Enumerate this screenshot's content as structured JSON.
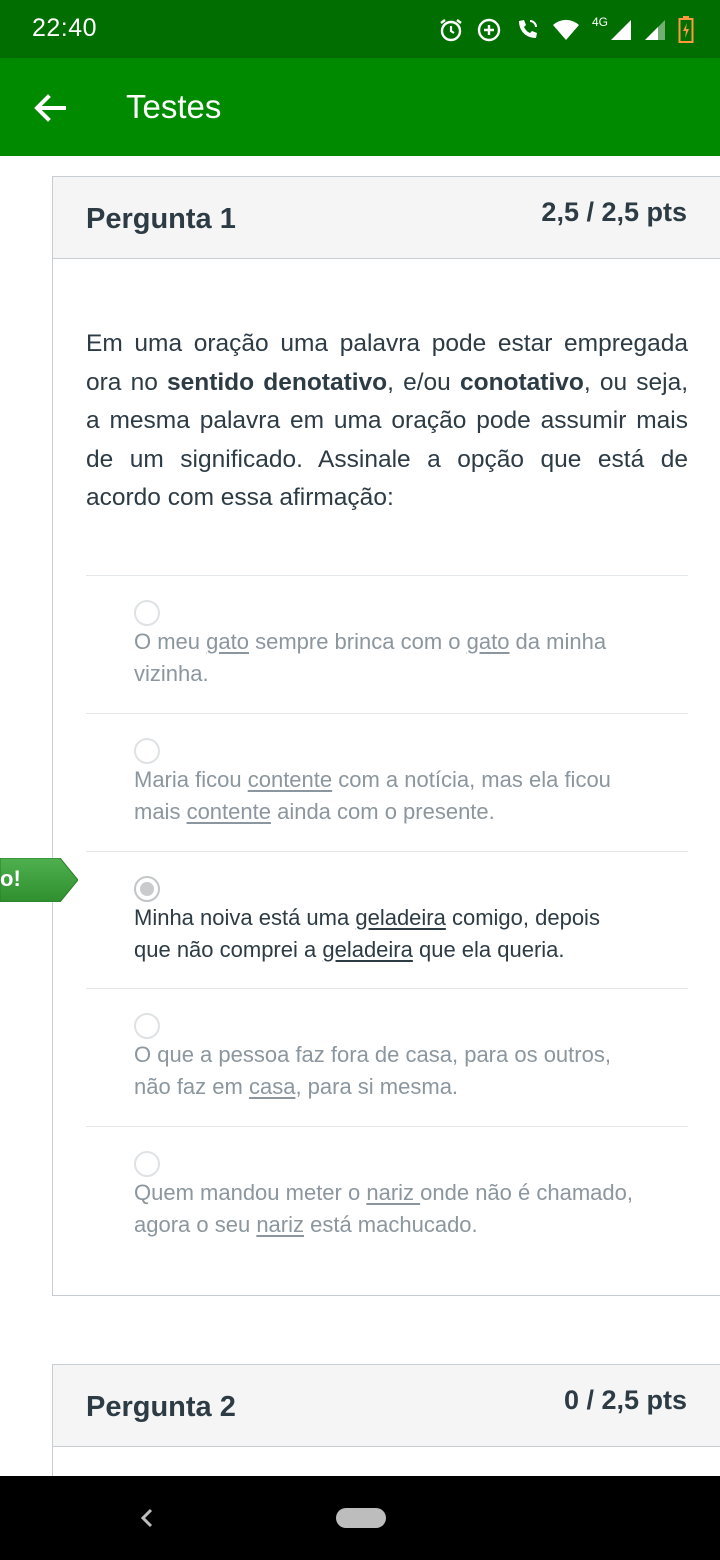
{
  "status_bar": {
    "time": "22:40",
    "network_label": "4G",
    "icons": [
      "alarm-icon",
      "data-saver-icon",
      "wifi-calling-icon",
      "wifi-icon",
      "signal-icon",
      "signal-icon-2",
      "battery-charging-icon"
    ]
  },
  "app_bar": {
    "title": "Testes",
    "back_icon": "arrow-left-icon"
  },
  "questions": [
    {
      "name": "Pergunta 1",
      "points": "2,5 / 2,5 pts",
      "text_parts": {
        "p1": "Em uma oração uma palavra pode estar empregada ora no ",
        "b1": "sentido denotativo",
        "p2": ", e/ou ",
        "b2": "conotativo",
        "p3": ", ou seja, a mesma palavra em uma oração pode assumir mais de um significado. Assinale a opção que está de acordo com essa afirmação:"
      },
      "answers": [
        {
          "parts": [
            "O meu ",
            "gato",
            " sempre brinca com o ",
            "gato",
            " da minha vizinha."
          ],
          "selected": false
        },
        {
          "parts": [
            "Maria ficou ",
            "contente",
            " com a notícia, mas ela ficou mais ",
            "contente",
            " ainda com o presente."
          ],
          "selected": false
        },
        {
          "parts": [
            "Minha noiva está uma ",
            "geladeira",
            " comigo, depois que não comprei a ",
            "geladeira",
            " que ela queria."
          ],
          "selected": true
        },
        {
          "parts": [
            "O que a pessoa faz fora de casa, para os outros, não faz em ",
            "casa",
            ", para si mesma."
          ],
          "selected": false
        },
        {
          "parts": [
            "Quem mandou meter o ",
            "nariz ",
            "onde não é chamado, agora o seu ",
            "nariz",
            " está machucado."
          ],
          "selected": false
        }
      ],
      "correct_flag_text": "o!"
    },
    {
      "name": "Pergunta 2",
      "points": "0 / 2,5 pts"
    }
  ],
  "colors": {
    "status_bar": "#006e00",
    "app_bar": "#008a00",
    "text": "#2d3b45",
    "muted_text": "#8b969e",
    "correct_flag": "#3a9e3a"
  }
}
